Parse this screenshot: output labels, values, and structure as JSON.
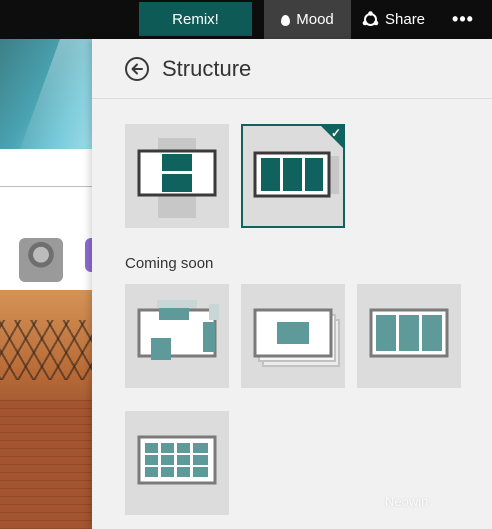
{
  "topbar": {
    "remix_label": "Remix!",
    "mood_label": "Mood",
    "share_label": "Share",
    "more_label": "•••"
  },
  "panel": {
    "title": "Structure",
    "coming_soon_label": "Coming soon",
    "available_layouts": [
      {
        "icon": "vertical-scroll-layout-icon",
        "selected": false
      },
      {
        "icon": "horizontal-columns-layout-icon",
        "selected": true
      }
    ],
    "coming_soon_layouts": [
      {
        "icon": "freeform-layout-icon"
      },
      {
        "icon": "stacked-cards-layout-icon"
      },
      {
        "icon": "three-panel-layout-icon"
      },
      {
        "icon": "grid-layout-icon"
      }
    ]
  },
  "watermark": "Neowin",
  "colors": {
    "accent": "#10625f",
    "remix_button": "#0e5a57",
    "topbar": "#0d0d0d",
    "mood_button": "#3f3f3f",
    "panel_bg": "#f1f1f1",
    "tile_bg": "#dcdcdc"
  }
}
